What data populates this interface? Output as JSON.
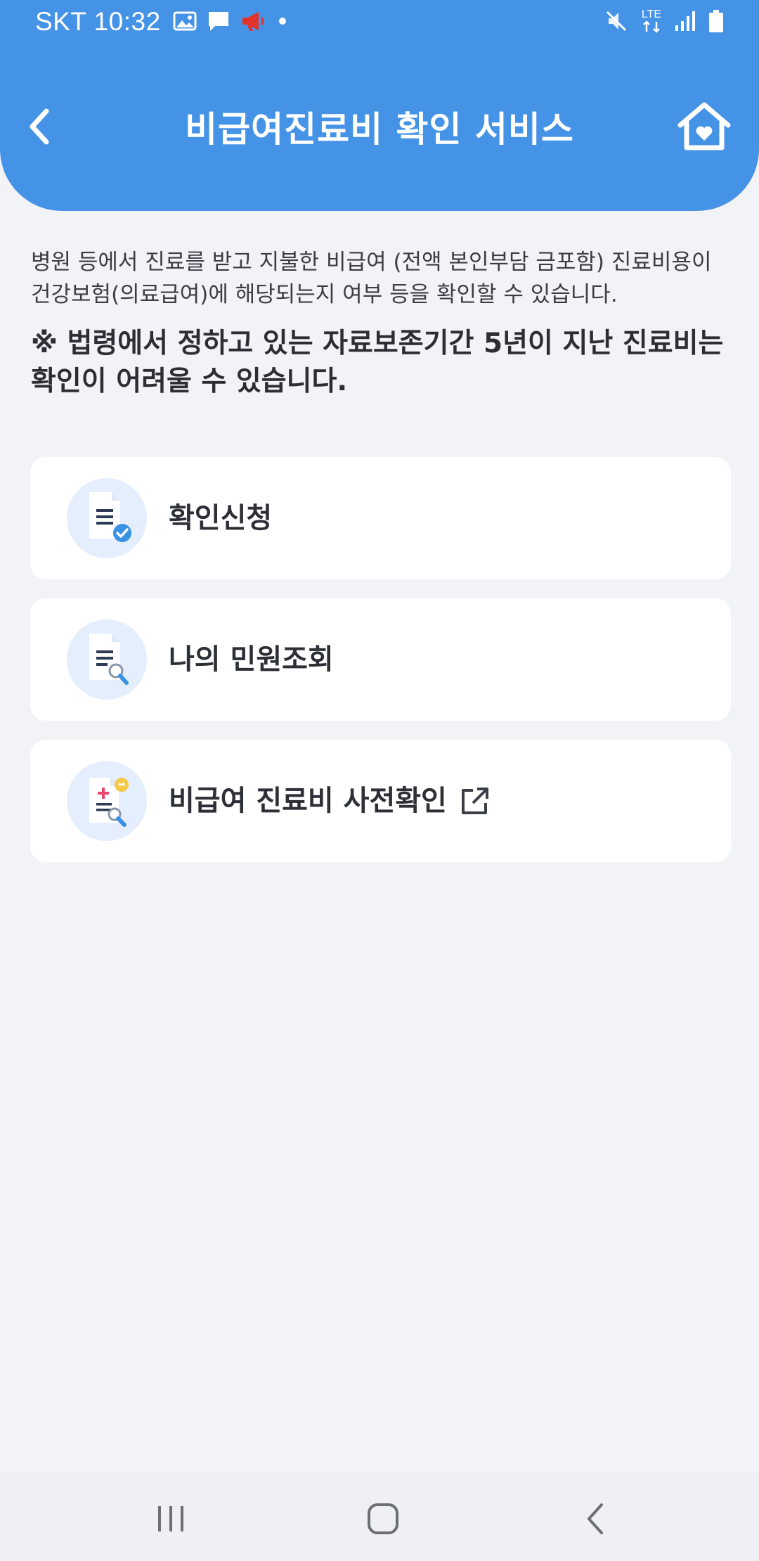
{
  "status_bar": {
    "time": "SKT 10:32",
    "lte_label": "LTE"
  },
  "header": {
    "title": "비급여진료비 확인 서비스"
  },
  "content": {
    "description": "병원 등에서 진료를 받고 지불한 비급여 (전액 본인부담 금포함) 진료비용이 건강보험(의료급여)에 해당되는지 여부 등을 확인할 수 있습니다.",
    "notice": "※ 법령에서 정하고 있는 자료보존기간 5년이 지난 진료비는 확인이 어려울 수 있습니다."
  },
  "menu": {
    "items": [
      {
        "label": "확인신청",
        "icon": "document-check-icon"
      },
      {
        "label": "나의 민원조회",
        "icon": "document-search-icon"
      },
      {
        "label": "비급여 진료비 사전확인",
        "icon": "medical-document-search-icon",
        "external": true
      }
    ]
  },
  "colors": {
    "header": "#4593e6",
    "background": "#f1f3f6",
    "card": "#ffffff",
    "icon_circle": "#e4eefc",
    "accent_blue": "#3a92e4"
  }
}
